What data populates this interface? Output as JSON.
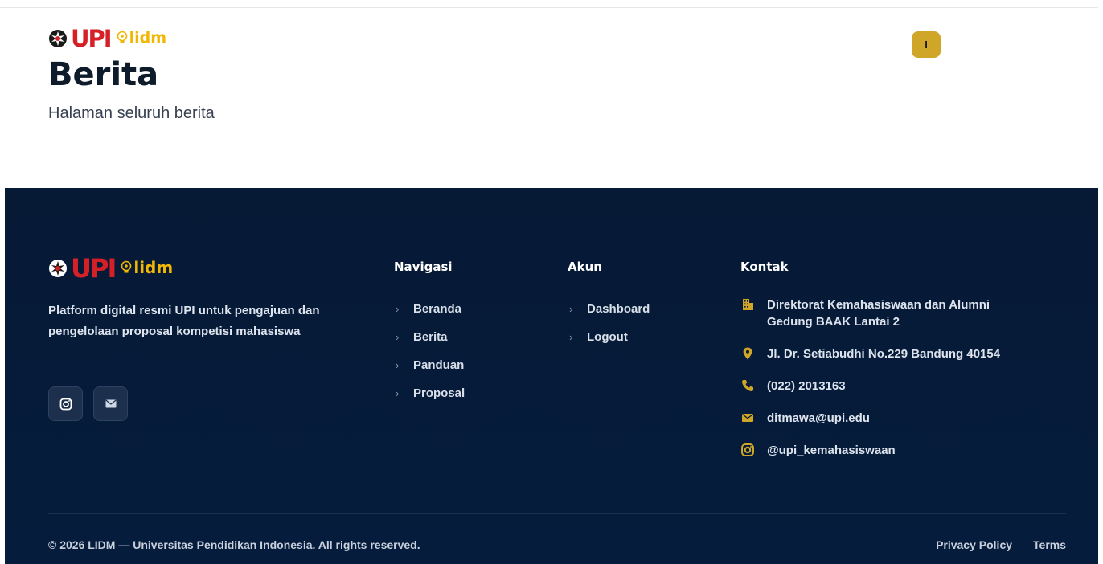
{
  "header": {
    "logo": {
      "upi_text": "UPI",
      "lidm_text": "lidm"
    },
    "title": "Berita",
    "subtitle": "Halaman seluruh berita",
    "user_initial": "I"
  },
  "footer": {
    "logo": {
      "upi_text": "UPI",
      "lidm_text": "lidm"
    },
    "description": "Platform digital resmi UPI untuk pengajuan dan pengelolaan proposal kompetisi mahasiswa",
    "social": [
      {
        "icon": "instagram-icon"
      },
      {
        "icon": "mail-icon"
      }
    ],
    "navigasi": {
      "title": "Navigasi",
      "items": [
        "Beranda",
        "Berita",
        "Panduan",
        "Proposal"
      ]
    },
    "akun": {
      "title": "Akun",
      "items": [
        "Dashboard",
        "Logout"
      ]
    },
    "kontak": {
      "title": "Kontak",
      "address_line1": "Direktorat Kemahasiswaan dan Alumni",
      "address_line2": "Gedung BAAK Lantai 2",
      "street": "Jl. Dr. Setiabudhi No.229 Bandung 40154",
      "phone": "(022) 2013163",
      "email": "ditmawa@upi.edu",
      "instagram": "@upi_kemahasiswaan"
    },
    "copyright": "© 2026 LIDM — Universitas Pendidikan Indonesia. All rights reserved.",
    "legal": {
      "privacy": "Privacy Policy",
      "terms": "Terms"
    }
  },
  "colors": {
    "footer_bg": "#061a36",
    "accent_gold": "#cfa628",
    "upi_red": "#d62027",
    "lidm_yellow": "#f2b705"
  }
}
